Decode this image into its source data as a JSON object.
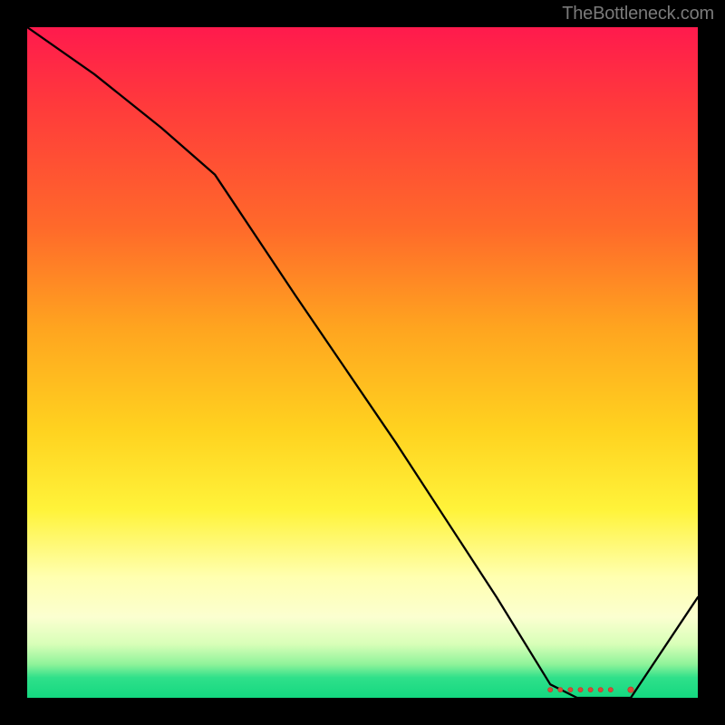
{
  "watermark": "TheBottleneck.com",
  "chart_data": {
    "type": "line",
    "title": "",
    "xlabel": "",
    "ylabel": "",
    "x_range": [
      0,
      100
    ],
    "y_range": [
      0,
      100
    ],
    "series": [
      {
        "name": "bottleneck-curve",
        "x": [
          0,
          10,
          20,
          28,
          40,
          55,
          70,
          78,
          82,
          86,
          90,
          100
        ],
        "y": [
          100,
          93,
          85,
          78,
          60,
          38,
          15,
          2,
          0,
          0,
          0,
          15
        ]
      }
    ],
    "markers": {
      "name": "highlight-cluster",
      "x": [
        78,
        79.5,
        81,
        82.5,
        84,
        85.5,
        87,
        90
      ],
      "y": [
        1.2,
        1.2,
        1.2,
        1.2,
        1.2,
        1.2,
        1.2,
        1.2
      ]
    },
    "background_gradient": [
      {
        "stop": 0,
        "color": "#ff1a4d"
      },
      {
        "stop": 50,
        "color": "#ffcc1f"
      },
      {
        "stop": 85,
        "color": "#ffffc0"
      },
      {
        "stop": 100,
        "color": "#14d880"
      }
    ]
  }
}
